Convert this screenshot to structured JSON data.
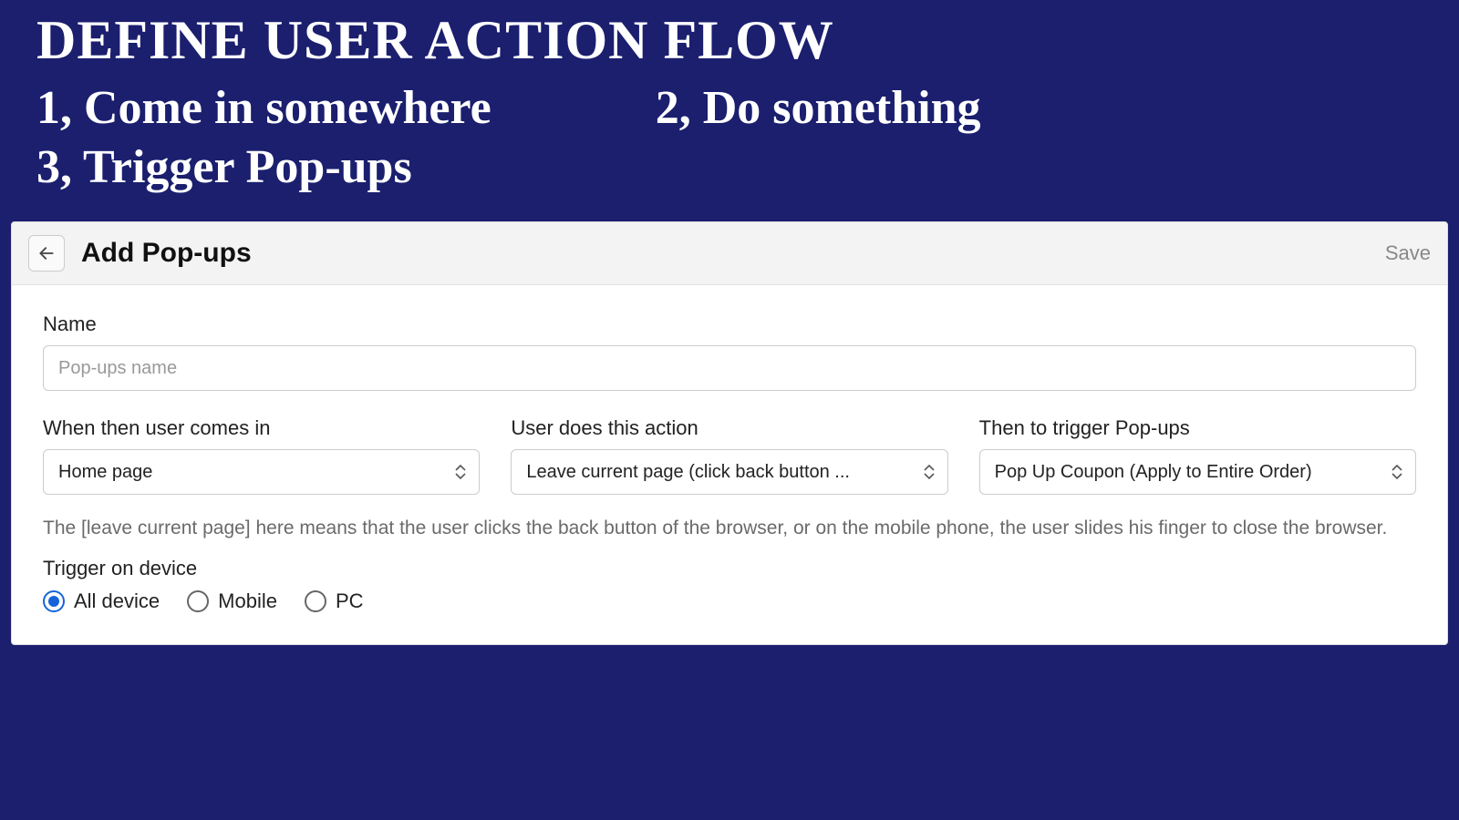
{
  "slide": {
    "title": "DEFINE USER ACTION FLOW",
    "step1": "1,  Come in somewhere",
    "step2": "2, Do something",
    "step3": "3, Trigger Pop-ups"
  },
  "panel": {
    "title": "Add Pop-ups",
    "save_label": "Save"
  },
  "form": {
    "name_label": "Name",
    "name_placeholder": "Pop-ups name",
    "comes_in_label": "When then user comes in",
    "comes_in_value": "Home page",
    "action_label": "User does this action",
    "action_value": "Leave current page (click back button ...",
    "trigger_label": "Then to trigger Pop-ups",
    "trigger_value": "Pop Up Coupon (Apply to Entire Order)",
    "hint": "The [leave current page] here means that the user clicks the back button of the browser, or on the mobile phone, the user slides his finger to close the browser.",
    "device_label": "Trigger on device",
    "device_options": {
      "all": "All device",
      "mobile": "Mobile",
      "pc": "PC"
    },
    "device_selected": "all"
  }
}
